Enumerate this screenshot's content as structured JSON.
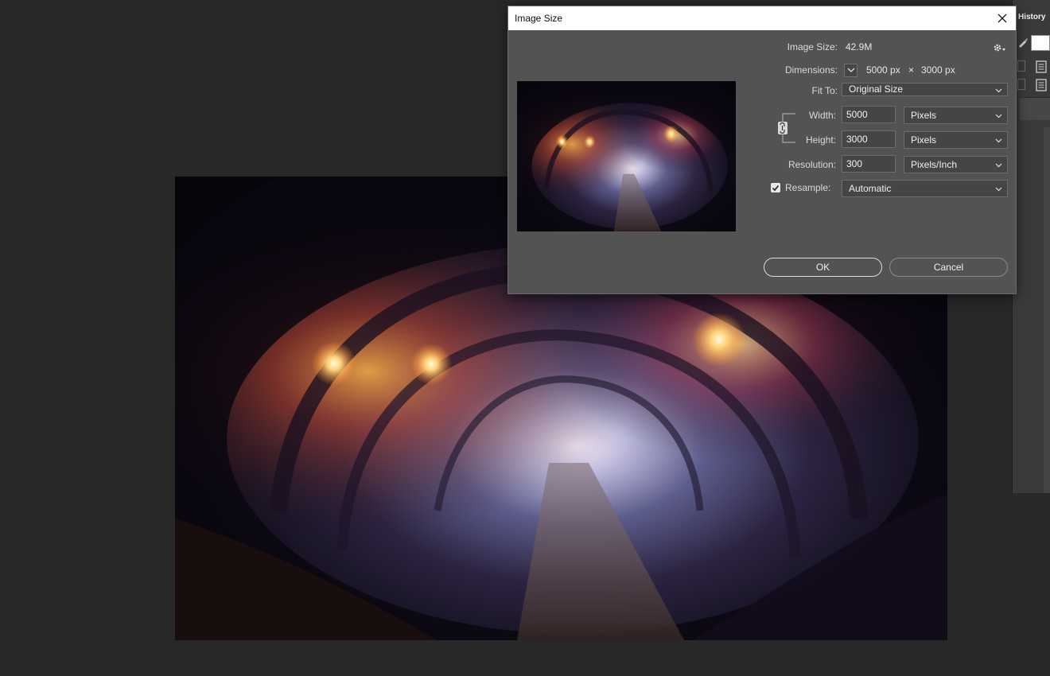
{
  "panel": {
    "tab_label": "History"
  },
  "dialog": {
    "title": "Image Size",
    "image_size_label": "Image Size:",
    "image_size_value": "42.9M",
    "dimensions_label": "Dimensions:",
    "dimensions_width": "5000 px",
    "dimensions_sep": "×",
    "dimensions_height": "3000 px",
    "fit_to_label": "Fit To:",
    "fit_to_value": "Original Size",
    "width_label": "Width:",
    "width_value": "5000",
    "width_unit": "Pixels",
    "height_label": "Height:",
    "height_value": "3000",
    "height_unit": "Pixels",
    "resolution_label": "Resolution:",
    "resolution_value": "300",
    "resolution_unit": "Pixels/Inch",
    "resample_label": "Resample:",
    "resample_checked": true,
    "resample_value": "Automatic",
    "ok_label": "OK",
    "cancel_label": "Cancel"
  },
  "icons": {
    "close": "close-icon",
    "gear": "gear-icon",
    "dimensions_toggle": "chevron-down-icon",
    "link": "chain-link-icon",
    "checkbox": "checkmark-icon"
  },
  "colors": {
    "dialog_bg": "#535353",
    "titlebar_bg": "#ffffff",
    "workspace_bg": "#282828"
  }
}
